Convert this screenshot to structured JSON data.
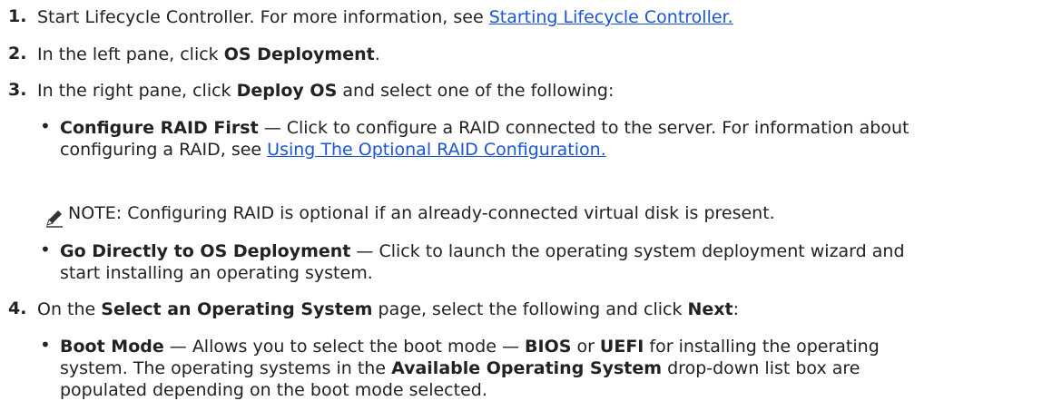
{
  "steps": [
    {
      "number": "1.",
      "text": "Start Lifecycle Controller. For more information, see ",
      "link": "Starting Lifecycle Controller."
    },
    {
      "number": "2.",
      "pre": "In the left pane, click ",
      "bold": "OS Deployment",
      "post": "."
    },
    {
      "number": "3.",
      "pre": "In the right pane, click ",
      "bold": "Deploy OS",
      "post": " and select one of the following:",
      "options": [
        {
          "bullet": "•",
          "title": "Configure RAID First",
          "text1": " — Click to configure a RAID connected to the server. For information about",
          "text2": "configuring a RAID, see ",
          "link": "Using The Optional RAID Configuration."
        },
        {
          "bullet": "•",
          "title": "Go Directly to OS Deployment",
          "text1": " — Click to launch the operating system deployment wizard and",
          "text2": "start installing an operating system."
        }
      ],
      "note": {
        "icon": "pencil-note-icon",
        "label": "NOTE:",
        "text": " Configuring RAID is optional if an already-connected virtual disk is present."
      }
    },
    {
      "number": "4.",
      "pre": "On the ",
      "bold1": "Select an Operating System",
      "mid": " page, select the following and click ",
      "bold2": "Next",
      "post": ":",
      "options": [
        {
          "bullet": "•",
          "title": "Boot Mode",
          "text1a": " — Allows you to select the boot mode — ",
          "bios": "BIOS",
          "or": " or ",
          "uefi": "UEFI",
          "text1b": " for installing the operating",
          "text2a": "system. The operating systems in the ",
          "bold": "Available Operating System",
          "text2b": " drop-down list box are",
          "text3": "populated depending on the boot mode selected."
        }
      ]
    }
  ]
}
